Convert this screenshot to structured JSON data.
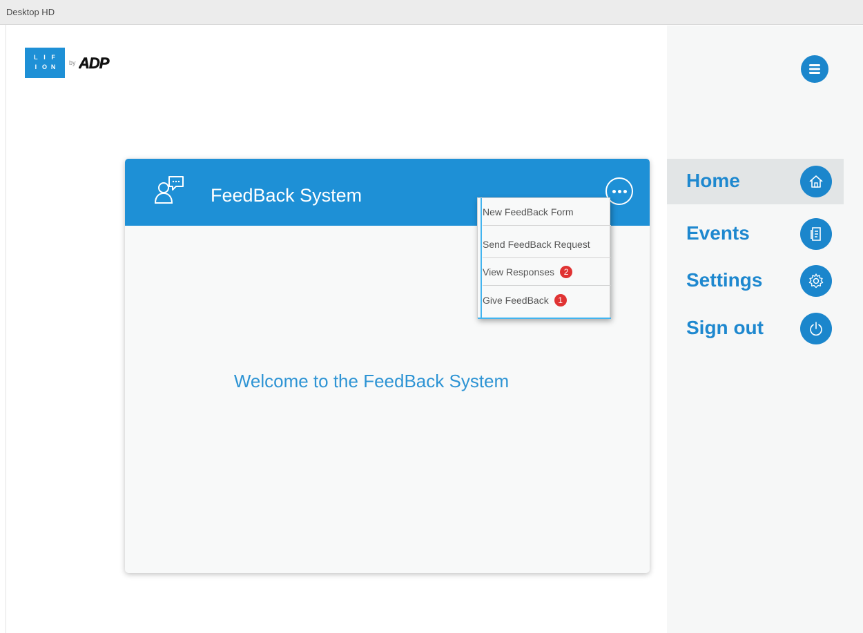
{
  "frame": {
    "label": "Desktop HD"
  },
  "logo": {
    "letters": [
      "L",
      "I",
      "F",
      "I",
      "O",
      "N"
    ],
    "by": "by",
    "brand": "ADP"
  },
  "header_menu": {
    "icon": "hamburger-icon"
  },
  "card": {
    "title": "FeedBack System",
    "header_icon": "chat-user-icon",
    "more_icon": "more-dots-icon",
    "welcome": "Welcome to the FeedBack System"
  },
  "dropdown": {
    "items": [
      {
        "label": "New FeedBack Form"
      },
      {
        "label": "Send FeedBack Request"
      },
      {
        "label": "View Responses",
        "badge": "2"
      },
      {
        "label": "Give FeedBack",
        "badge": "1"
      }
    ]
  },
  "nav": {
    "items": [
      {
        "label": "Home",
        "icon": "home-icon",
        "active": true
      },
      {
        "label": "Events",
        "icon": "document-icon"
      },
      {
        "label": "Settings",
        "icon": "gear-icon"
      },
      {
        "label": "Sign out",
        "icon": "power-icon"
      }
    ]
  },
  "colors": {
    "primary": "#1e90d6",
    "nav_text": "#1e88cf",
    "badge": "#e03333",
    "sidebar_bg": "#f6f7f7",
    "active_bg": "#e2e5e6"
  }
}
